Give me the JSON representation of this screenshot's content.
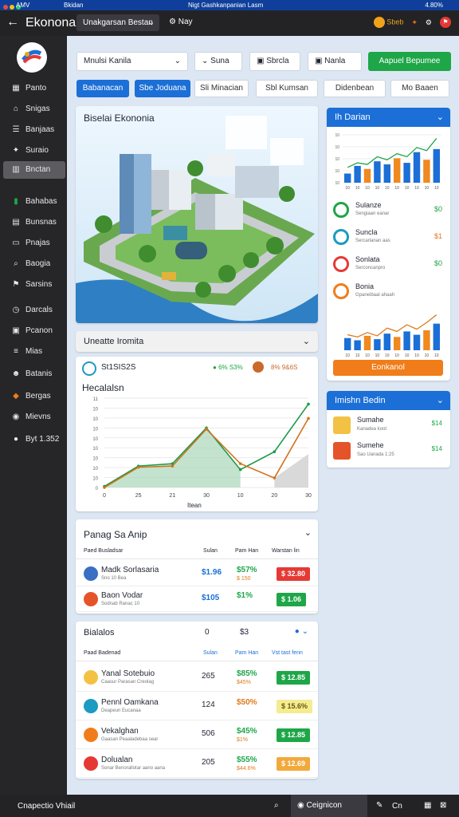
{
  "status_bar": {
    "left": "AMV",
    "app": "Bkidan",
    "center": "Nigt Gashkanpanian Lasm",
    "right": "4.80%"
  },
  "topbar": {
    "title": "Ekonona",
    "dropdown": "Unakgarsan Bestan",
    "menu": "Nay",
    "coin_label": "Sbeb"
  },
  "sidebar": {
    "items": [
      {
        "label": "Panto",
        "icon": "grid-icon"
      },
      {
        "label": "Snigas",
        "icon": "home-icon"
      },
      {
        "label": "Banjaas",
        "icon": "list-icon"
      },
      {
        "label": "Suraio",
        "icon": "star-icon"
      },
      {
        "label": "Bnctan",
        "icon": "bank-icon",
        "active": true
      },
      {
        "label": "Bahabas",
        "icon": "chart-icon"
      },
      {
        "label": "Bunsnas",
        "icon": "doc-icon"
      },
      {
        "label": "Pnajas",
        "icon": "folder-icon"
      },
      {
        "label": "Baogia",
        "icon": "search-icon"
      },
      {
        "label": "Sarsins",
        "icon": "flag-icon"
      },
      {
        "label": "Darcals",
        "icon": "clock-icon"
      },
      {
        "label": "Pcanon",
        "icon": "box-icon"
      },
      {
        "label": "Mias",
        "icon": "menu-icon"
      },
      {
        "label": "Batanis",
        "icon": "user-icon"
      },
      {
        "label": "Bergas",
        "icon": "tag-icon"
      },
      {
        "label": "Mievns",
        "icon": "circle-icon"
      },
      {
        "label": "Byt 1.352",
        "icon": "globe-icon"
      }
    ]
  },
  "filters": {
    "select1": "Mnulsi Kanila",
    "select2": "Suna",
    "select3": "Sbrcla",
    "select4": "Nanla",
    "action": "Aapuel Bepumee"
  },
  "pills": [
    "Babanacan",
    "Sbe Joduana",
    "Sli Minacian",
    "Sbl Kumsan",
    "Didenbean",
    "Mo Baaen"
  ],
  "hero": {
    "title": "Biselai Ekononia"
  },
  "collapse": {
    "label": "Uneatte Iromita"
  },
  "line_card": {
    "badge": "St1SIS2S",
    "stat1": "6% S3%",
    "stat2": "8% 9&6S",
    "title": "Hecalalsn",
    "xlabel": "Itean"
  },
  "chart_data": [
    {
      "type": "line",
      "title": "Hecalalsn",
      "xlabel": "Itean",
      "x": [
        0,
        25,
        21,
        30,
        10,
        20,
        30
      ],
      "series": [
        {
          "values": [
            1,
            18,
            20,
            50,
            15,
            30,
            70
          ],
          "color": "#1e9a4a"
        },
        {
          "values": [
            0,
            17,
            18,
            49,
            20,
            8,
            58
          ],
          "color": "#d0741c"
        }
      ],
      "y_ticks": [
        "11",
        "10",
        "10",
        "10",
        "10",
        "10",
        "10",
        "10",
        "10",
        "0"
      ]
    },
    {
      "type": "bar",
      "title": "Ih Darian",
      "categories": [
        "10",
        "10",
        "10",
        "10",
        "10",
        "10",
        "10",
        "10",
        "10",
        "10"
      ],
      "values": [
        12,
        22,
        18,
        28,
        24,
        32,
        26,
        40,
        30,
        44
      ],
      "line": [
        20,
        26,
        24,
        34,
        30,
        38,
        34,
        46,
        42,
        58
      ],
      "y_ticks": [
        "10",
        "10",
        "10",
        "10",
        "10"
      ]
    },
    {
      "type": "bar",
      "categories": [
        "10",
        "10",
        "10",
        "10",
        "10",
        "10",
        "10",
        "10",
        "10",
        "10"
      ],
      "values": [
        22,
        18,
        26,
        20,
        30,
        24,
        34,
        28,
        36,
        48
      ],
      "line": [
        28,
        24,
        32,
        26,
        40,
        34,
        46,
        38,
        50,
        64
      ]
    }
  ],
  "right_card1": {
    "title": "Ih Darian",
    "rows": [
      {
        "name": "Sulanze",
        "sub": "Sengiaan eanar",
        "value": "$0"
      },
      {
        "name": "Suncla",
        "sub": "Sercarlanan aas",
        "value": "$1"
      },
      {
        "name": "Sonlata",
        "sub": "Serconcanpro",
        "value": "$0"
      },
      {
        "name": "Bonia",
        "sub": "Gpaneibaal ahaah",
        "value": ""
      }
    ],
    "button": "Eonkanol"
  },
  "right_card2": {
    "title": "Imishn Bedin",
    "rows": [
      {
        "name": "Sumahe",
        "sub": "Kanadea koot",
        "value": "$14"
      },
      {
        "name": "Sumehe",
        "sub": "Sao Uanada 1:25",
        "value": "$14"
      }
    ]
  },
  "table1": {
    "title": "Panag Sa Anip",
    "cols": [
      "Paed Busladsar",
      "Sulan",
      "Pam Han",
      "Warstan lin"
    ],
    "rows": [
      {
        "name": "Madk Sorlasaria",
        "sub": "Sno 10 Bea",
        "c1": "$1.96",
        "c2": "$57%",
        "c2sub": "$ 150",
        "badge": "$ 32.80",
        "badge_color": "#e53935"
      },
      {
        "name": "Baon Vodar",
        "sub": "Sodnab Ranac 10",
        "c1": "$105",
        "c2": "$1%",
        "c2sub": "",
        "badge": "$ 1.06",
        "badge_color": "#1ea648"
      }
    ]
  },
  "table2": {
    "title": "Bialalos",
    "mid1": "0",
    "mid2": "$3",
    "cols": [
      "Paad Badenad",
      "Sulan",
      "Pam Han",
      "Vst tast fenn"
    ],
    "rows": [
      {
        "name": "Yanal Sotebuio",
        "sub": "Caasur Parasan Creolag",
        "c1": "265",
        "c2": "$85%",
        "c2sub": "$45%",
        "badge": "$ 12.85",
        "badge_color": "#1ea648"
      },
      {
        "name": "Pennl Oamkana",
        "sub": "Deapeun Eucanaa",
        "c1": "124",
        "c2": "$50%",
        "c2sub": "",
        "badge": "$ 15.6%",
        "badge_color": "#f5ec8f"
      },
      {
        "name": "Vekalghan",
        "sub": "Gaasan Peaaladebaa sear",
        "c1": "506",
        "c2": "$45%",
        "c2sub": "$1%",
        "badge": "$ 12.85",
        "badge_color": "#1ea648"
      },
      {
        "name": "Dolualan",
        "sub": "Sonar Benorallotar aano aana",
        "c1": "205",
        "c2": "$55%",
        "c2sub": "$44.6%",
        "badge": "$ 12.69",
        "badge_color": "#f2a93b"
      }
    ]
  },
  "taskbar": {
    "left": "Cnapectio Vhiail",
    "tab": "Ceignicon",
    "right": "Cn"
  }
}
